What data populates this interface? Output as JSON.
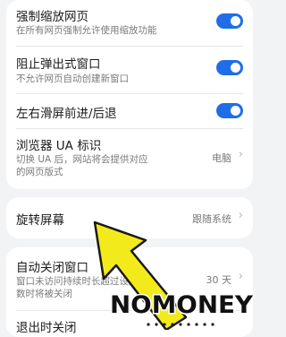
{
  "settings": {
    "force_zoom": {
      "title": "强制缩放网页",
      "subtitle": "在所有网页强制允许使用缩放功能",
      "on": true
    },
    "block_popups": {
      "title": "阻止弹出式窗口",
      "subtitle": "不允许网页自动创建新窗口",
      "on": true
    },
    "swipe_nav": {
      "title": "左右滑屏前进/后退",
      "on": true
    },
    "ua": {
      "title": "浏览器 UA 标识",
      "subtitle_1": "切换 UA 后，网站将会提供对应",
      "subtitle_2": "的网页版式",
      "value": "电脑",
      "chevron": "›"
    },
    "rotate": {
      "title": "旋转屏幕",
      "value": "跟随系统",
      "chevron": "›"
    },
    "auto_close": {
      "title": "自动关闭窗口",
      "subtitle_1": "窗口未访问持续时长超过设定",
      "subtitle_2": "数时将被关闭",
      "value": "30 天",
      "chevron": "›"
    },
    "exit_close": {
      "title": "退出时关闭"
    }
  },
  "watermark": {
    "text": "NOMONEY"
  },
  "colors": {
    "accent": "#1f6ee8",
    "arrow": "#f3ea1c",
    "background": "#f1f3f5"
  }
}
